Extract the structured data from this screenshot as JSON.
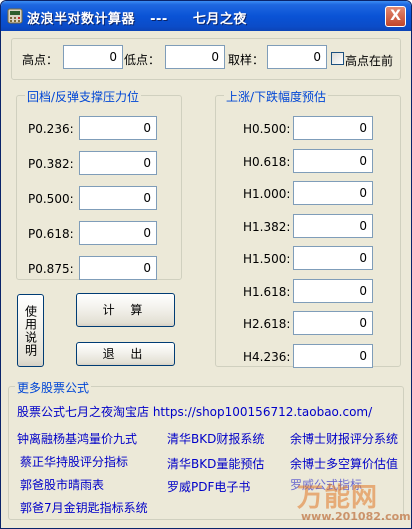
{
  "window": {
    "title": "波浪半对数计算器   ---     七月之夜",
    "close_glyph": "X"
  },
  "inputs_top": {
    "high_label": "高点：",
    "high_value": "0",
    "low_label": "低点：",
    "low_value": "0",
    "sample_label": "取样：",
    "sample_value": "0",
    "high_first_label": "高点在前",
    "high_first_checked": false
  },
  "retrace": {
    "title": "回档/反弹支撑压力位",
    "rows": [
      {
        "label": "P0.236:",
        "value": "0"
      },
      {
        "label": "P0.382:",
        "value": "0"
      },
      {
        "label": "P0.500:",
        "value": "0"
      },
      {
        "label": "P0.618:",
        "value": "0"
      },
      {
        "label": "P0.875:",
        "value": "0"
      }
    ]
  },
  "projection": {
    "title": "上涨/下跌幅度预估",
    "rows": [
      {
        "label": "H0.500:",
        "value": "0"
      },
      {
        "label": "H0.618:",
        "value": "0"
      },
      {
        "label": "H1.000:",
        "value": "0"
      },
      {
        "label": "H1.382:",
        "value": "0"
      },
      {
        "label": "H1.500:",
        "value": "0"
      },
      {
        "label": "H1.618:",
        "value": "0"
      },
      {
        "label": "H2.618:",
        "value": "0"
      },
      {
        "label": "H4.236:",
        "value": "0"
      }
    ]
  },
  "buttons": {
    "help": "使用说明",
    "calculate": "计 算",
    "exit": "退 出"
  },
  "more": {
    "title": "更多股票公式",
    "shop_link": "股票公式七月之夜淘宝店 https://shop100156712.taobao.com/",
    "links": [
      "钟离融杨基鸿量价九式",
      "清华BKD财报系统",
      "余博士财报评分系统",
      "蔡正华持股评分指标",
      "清华BKD量能预估",
      "余博士多空算价估值",
      "郭爸股市晴雨表",
      "罗威PDF电子书",
      "罗威公式指标",
      "郭爸7月金钥匙指标系统"
    ]
  },
  "watermark": {
    "brand": "万能网",
    "url": "www.201082.com"
  },
  "colors": {
    "title_bar": "#0a53d6",
    "group_title": "#0046d5",
    "link": "#0000c8",
    "window_bg": "#ece9d8"
  }
}
